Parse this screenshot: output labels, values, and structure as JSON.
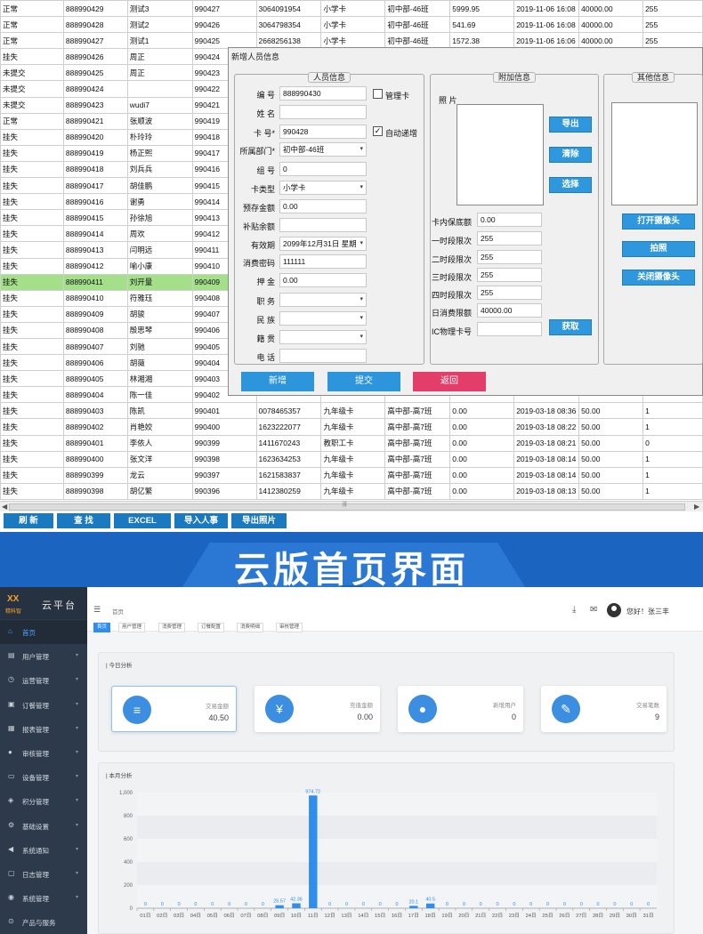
{
  "grid": {
    "rows": [
      [
        "正常",
        "888990429",
        "测试3",
        "990427",
        "3064091954",
        "小学卡",
        "初中部-46班",
        "5999.95",
        "2019-11-06 16:08",
        "40000.00",
        "255"
      ],
      [
        "正常",
        "888990428",
        "测试2",
        "990426",
        "3064798354",
        "小学卡",
        "初中部-46班",
        "541.69",
        "2019-11-06 16:08",
        "40000.00",
        "255"
      ],
      [
        "正常",
        "888990427",
        "测试1",
        "990425",
        "2668256138",
        "小学卡",
        "初中部-46班",
        "1572.38",
        "2019-11-06 16:06",
        "40000.00",
        "255"
      ],
      [
        "挂失",
        "888990426",
        "周正",
        "990424",
        "",
        "",
        "",
        "",
        "",
        "",
        ""
      ],
      [
        "未提交",
        "888990425",
        "周正",
        "990423",
        "",
        "",
        "",
        "",
        "",
        "",
        ""
      ],
      [
        "未提交",
        "888990424",
        "",
        "990422",
        "",
        "",
        "",
        "",
        "",
        "",
        ""
      ],
      [
        "未提交",
        "888990423",
        "wudi7",
        "990421",
        "",
        "",
        "",
        "",
        "",
        "",
        ""
      ],
      [
        "正常",
        "888990421",
        "张顺波",
        "990419",
        "",
        "",
        "",
        "",
        "",
        "",
        ""
      ],
      [
        "挂失",
        "888990420",
        "朴玲玲",
        "990418",
        "",
        "",
        "",
        "",
        "",
        "",
        ""
      ],
      [
        "挂失",
        "888990419",
        "杨正熙",
        "990417",
        "",
        "",
        "",
        "",
        "",
        "",
        ""
      ],
      [
        "挂失",
        "888990418",
        "刘兵兵",
        "990416",
        "",
        "",
        "",
        "",
        "",
        "",
        ""
      ],
      [
        "挂失",
        "888990417",
        "胡佳鹏",
        "990415",
        "",
        "",
        "",
        "",
        "",
        "",
        ""
      ],
      [
        "挂失",
        "888990416",
        "谢勇",
        "990414",
        "",
        "",
        "",
        "",
        "",
        "",
        ""
      ],
      [
        "挂失",
        "888990415",
        "孙徐旭",
        "990413",
        "",
        "",
        "",
        "",
        "",
        "",
        ""
      ],
      [
        "挂失",
        "888990414",
        "周欢",
        "990412",
        "",
        "",
        "",
        "",
        "",
        "",
        ""
      ],
      [
        "挂失",
        "888990413",
        "闫明远",
        "990411",
        "",
        "",
        "",
        "",
        "",
        "",
        ""
      ],
      [
        "挂失",
        "888990412",
        "喻小康",
        "990410",
        "",
        "",
        "",
        "",
        "",
        "",
        ""
      ],
      [
        "挂失",
        "888990411",
        "刘开量",
        "990409",
        "",
        "",
        "",
        "",
        "",
        "",
        ""
      ],
      [
        "挂失",
        "888990410",
        "符雅珏",
        "990408",
        "",
        "",
        "",
        "",
        "",
        "",
        ""
      ],
      [
        "挂失",
        "888990409",
        "胡骏",
        "990407",
        "",
        "",
        "",
        "",
        "",
        "",
        ""
      ],
      [
        "挂失",
        "888990408",
        "殷思琴",
        "990406",
        "",
        "",
        "",
        "",
        "",
        "",
        ""
      ],
      [
        "挂失",
        "888990407",
        "刘驰",
        "990405",
        "",
        "",
        "",
        "",
        "",
        "",
        ""
      ],
      [
        "挂失",
        "888990406",
        "胡薇",
        "990404",
        "",
        "",
        "",
        "",
        "",
        "",
        ""
      ],
      [
        "挂失",
        "888990405",
        "林湘湘",
        "990403",
        "",
        "",
        "",
        "",
        "",
        "",
        ""
      ],
      [
        "挂失",
        "888990404",
        "陈一佳",
        "990402",
        "",
        "",
        "",
        "",
        "",
        "",
        ""
      ],
      [
        "挂失",
        "888990403",
        "陈凯",
        "990401",
        "0078465357",
        "九年级卡",
        "高中部-高7班",
        "0.00",
        "2019-03-18 08:36",
        "50.00",
        "1"
      ],
      [
        "挂失",
        "888990402",
        "肖艳姣",
        "990400",
        "1623222077",
        "九年级卡",
        "高中部-高7班",
        "0.00",
        "2019-03-18 08:22",
        "50.00",
        "1"
      ],
      [
        "挂失",
        "888990401",
        "李依人",
        "990399",
        "1411670243",
        "教职工卡",
        "高中部-高7班",
        "0.00",
        "2019-03-18 08:21",
        "50.00",
        "0"
      ],
      [
        "挂失",
        "888990400",
        "张文洋",
        "990398",
        "1623634253",
        "九年级卡",
        "高中部-高7班",
        "0.00",
        "2019-03-18 08:14",
        "50.00",
        "1"
      ],
      [
        "挂失",
        "888990399",
        "龙云",
        "990397",
        "1621583837",
        "九年级卡",
        "高中部-高7班",
        "0.00",
        "2019-03-18 08:14",
        "50.00",
        "1"
      ],
      [
        "挂失",
        "888990398",
        "胡亿繁",
        "990396",
        "1412380259",
        "九年级卡",
        "高中部-高7班",
        "0.00",
        "2019-03-18 08:13",
        "50.00",
        "1"
      ]
    ],
    "selected_row": 17
  },
  "toolbar": {
    "refresh": "刷 新",
    "search": "查 找",
    "excel": "EXCEL",
    "import": "导入人事",
    "export_photo": "导出照片"
  },
  "dialog": {
    "title": "新增人员信息",
    "section_person": "人员信息",
    "section_extra": "附加信息",
    "section_other": "其他信息",
    "fields": {
      "number_label": "编 号",
      "number_value": "888990430",
      "name_label": "姓 名",
      "name_value": "",
      "card_label": "卡 号*",
      "card_value": "990428",
      "dept_label": "所属部门*",
      "dept_value": "初中部-46班",
      "group_label": "组 号",
      "group_value": "0",
      "cardtype_label": "卡类型",
      "cardtype_value": "小学卡",
      "prestore_label": "预存金额",
      "prestore_value": "0.00",
      "subsidy_label": "补贴余额",
      "subsidy_value": "",
      "expiry_label": "有效期",
      "expiry_value": "2099年12月31日 星期",
      "password_label": "消费密码",
      "password_value": "111111",
      "deposit_label": "押 金",
      "deposit_value": "0.00",
      "position_label": "职 务",
      "ethnic_label": "民 族",
      "native_label": "籍 贯",
      "phone_label": "电 话"
    },
    "manager_checkbox": "管理卡",
    "auto_increment_checkbox": "自动递增",
    "photo_label": "照 片",
    "export_btn": "导出",
    "clear_btn": "清除",
    "select_btn": "选择",
    "extra": {
      "guarantee_label": "卡内保底额",
      "guarantee_value": "0.00",
      "p1_label": "一时段限次",
      "p1_value": "255",
      "p2_label": "二时段限次",
      "p2_value": "255",
      "p3_label": "三时段限次",
      "p3_value": "255",
      "p4_label": "四时段限次",
      "p4_value": "255",
      "daily_label": "日消费限额",
      "daily_value": "40000.00",
      "ic_label": "IC物理卡号",
      "ic_value": ""
    },
    "fetch_btn": "获取",
    "open_camera_btn": "打开摄像头",
    "capture_btn": "拍照",
    "close_camera_btn": "关闭摄像头",
    "add_btn": "新增",
    "submit_btn": "提交",
    "back_btn": "返回"
  },
  "banner": {
    "title": "云版首页界面"
  },
  "cloud": {
    "logo_mark": "XX",
    "logo_sub": "精科智",
    "logo_title": "云平台",
    "sidebar": [
      {
        "label": "首页",
        "icon": "home-icon",
        "glyph": "⌂"
      },
      {
        "label": "用户管理",
        "icon": "user-manage-icon",
        "glyph": "▤"
      },
      {
        "label": "运营管理",
        "icon": "operation-icon",
        "glyph": "◷"
      },
      {
        "label": "订餐管理",
        "icon": "cart-icon",
        "glyph": "▣"
      },
      {
        "label": "报表管理",
        "icon": "report-icon",
        "glyph": "▦"
      },
      {
        "label": "审核管理",
        "icon": "audit-icon",
        "glyph": "●"
      },
      {
        "label": "设备管理",
        "icon": "device-icon",
        "glyph": "▭"
      },
      {
        "label": "积分管理",
        "icon": "points-icon",
        "glyph": "◈"
      },
      {
        "label": "基础设置",
        "icon": "settings-icon",
        "glyph": "⚙"
      },
      {
        "label": "系统通知",
        "icon": "notice-icon",
        "glyph": "◀"
      },
      {
        "label": "日志管理",
        "icon": "log-icon",
        "glyph": "▢"
      },
      {
        "label": "系统管理",
        "icon": "system-icon",
        "glyph": "◉"
      },
      {
        "label": "产品与服务",
        "icon": "product-icon",
        "glyph": "⊙"
      }
    ],
    "breadcrumb": "首页",
    "greeting": "您好！张三丰",
    "tags": [
      "首页",
      "用户管理",
      "消费管理",
      "订餐配置",
      "消费明细",
      "审核管理"
    ],
    "today_title": "| 今日分析",
    "month_title": "| 本月分析",
    "cards": [
      {
        "label": "交易金额",
        "value": "40.50",
        "icon": "coins-icon",
        "glyph": "≡"
      },
      {
        "label": "充值金额",
        "value": "0.00",
        "icon": "moneybag-icon",
        "glyph": "¥"
      },
      {
        "label": "新增用户",
        "value": "0",
        "icon": "user-icon",
        "glyph": "●"
      },
      {
        "label": "交易笔数",
        "value": "9",
        "icon": "edit-icon",
        "glyph": "✎"
      }
    ]
  },
  "chart_data": {
    "type": "bar",
    "title": "本月分析",
    "categories": [
      "01日",
      "02日",
      "03日",
      "04日",
      "05日",
      "06日",
      "07日",
      "08日",
      "09日",
      "10日",
      "11日",
      "12日",
      "13日",
      "14日",
      "15日",
      "16日",
      "17日",
      "18日",
      "19日",
      "20日",
      "21日",
      "22日",
      "23日",
      "24日",
      "25日",
      "26日",
      "27日",
      "28日",
      "29日",
      "30日",
      "31日"
    ],
    "values": [
      0,
      0,
      0,
      0,
      0,
      0,
      0,
      0,
      25.57,
      42.36,
      974.72,
      0,
      0,
      0,
      0,
      0,
      20.1,
      40.5,
      0,
      0,
      0,
      0,
      0,
      0,
      0,
      0,
      0,
      0,
      0,
      0,
      0
    ],
    "value_labels": [
      "0",
      "0",
      "0",
      "0",
      "0",
      "0",
      "0",
      "0",
      "25.57",
      "42.36",
      "974.72",
      "0",
      "0",
      "0",
      "0",
      "0",
      "20.1",
      "40.5",
      "0",
      "0",
      "0",
      "0",
      "0",
      "0",
      "0",
      "0",
      "0",
      "0",
      "0",
      "0",
      "0"
    ],
    "yticks": [
      "0",
      "200",
      "400",
      "600",
      "800",
      "1,000"
    ],
    "ylim": [
      0,
      1000
    ],
    "color": "#2e8ded"
  }
}
